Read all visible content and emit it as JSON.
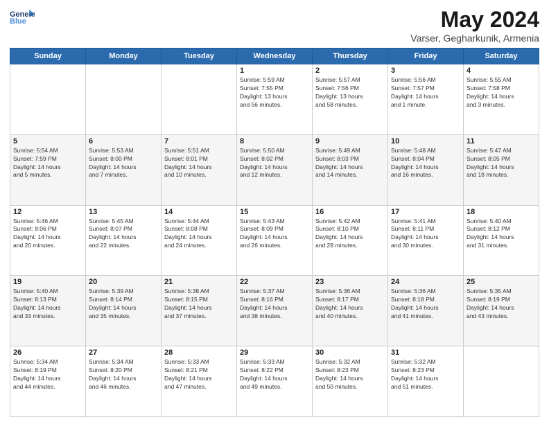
{
  "header": {
    "logo_line1": "General",
    "logo_line2": "Blue",
    "title": "May 2024",
    "location": "Varser, Gegharkunik, Armenia"
  },
  "weekdays": [
    "Sunday",
    "Monday",
    "Tuesday",
    "Wednesday",
    "Thursday",
    "Friday",
    "Saturday"
  ],
  "weeks": [
    {
      "days": [
        {
          "num": "",
          "info": ""
        },
        {
          "num": "",
          "info": ""
        },
        {
          "num": "",
          "info": ""
        },
        {
          "num": "1",
          "info": "Sunrise: 5:59 AM\nSunset: 7:55 PM\nDaylight: 13 hours\nand 56 minutes."
        },
        {
          "num": "2",
          "info": "Sunrise: 5:57 AM\nSunset: 7:56 PM\nDaylight: 13 hours\nand 58 minutes."
        },
        {
          "num": "3",
          "info": "Sunrise: 5:56 AM\nSunset: 7:57 PM\nDaylight: 14 hours\nand 1 minute."
        },
        {
          "num": "4",
          "info": "Sunrise: 5:55 AM\nSunset: 7:58 PM\nDaylight: 14 hours\nand 3 minutes."
        }
      ]
    },
    {
      "days": [
        {
          "num": "5",
          "info": "Sunrise: 5:54 AM\nSunset: 7:59 PM\nDaylight: 14 hours\nand 5 minutes."
        },
        {
          "num": "6",
          "info": "Sunrise: 5:53 AM\nSunset: 8:00 PM\nDaylight: 14 hours\nand 7 minutes."
        },
        {
          "num": "7",
          "info": "Sunrise: 5:51 AM\nSunset: 8:01 PM\nDaylight: 14 hours\nand 10 minutes."
        },
        {
          "num": "8",
          "info": "Sunrise: 5:50 AM\nSunset: 8:02 PM\nDaylight: 14 hours\nand 12 minutes."
        },
        {
          "num": "9",
          "info": "Sunrise: 5:49 AM\nSunset: 8:03 PM\nDaylight: 14 hours\nand 14 minutes."
        },
        {
          "num": "10",
          "info": "Sunrise: 5:48 AM\nSunset: 8:04 PM\nDaylight: 14 hours\nand 16 minutes."
        },
        {
          "num": "11",
          "info": "Sunrise: 5:47 AM\nSunset: 8:05 PM\nDaylight: 14 hours\nand 18 minutes."
        }
      ]
    },
    {
      "days": [
        {
          "num": "12",
          "info": "Sunrise: 5:46 AM\nSunset: 8:06 PM\nDaylight: 14 hours\nand 20 minutes."
        },
        {
          "num": "13",
          "info": "Sunrise: 5:45 AM\nSunset: 8:07 PM\nDaylight: 14 hours\nand 22 minutes."
        },
        {
          "num": "14",
          "info": "Sunrise: 5:44 AM\nSunset: 8:08 PM\nDaylight: 14 hours\nand 24 minutes."
        },
        {
          "num": "15",
          "info": "Sunrise: 5:43 AM\nSunset: 8:09 PM\nDaylight: 14 hours\nand 26 minutes."
        },
        {
          "num": "16",
          "info": "Sunrise: 5:42 AM\nSunset: 8:10 PM\nDaylight: 14 hours\nand 28 minutes."
        },
        {
          "num": "17",
          "info": "Sunrise: 5:41 AM\nSunset: 8:11 PM\nDaylight: 14 hours\nand 30 minutes."
        },
        {
          "num": "18",
          "info": "Sunrise: 5:40 AM\nSunset: 8:12 PM\nDaylight: 14 hours\nand 31 minutes."
        }
      ]
    },
    {
      "days": [
        {
          "num": "19",
          "info": "Sunrise: 5:40 AM\nSunset: 8:13 PM\nDaylight: 14 hours\nand 33 minutes."
        },
        {
          "num": "20",
          "info": "Sunrise: 5:39 AM\nSunset: 8:14 PM\nDaylight: 14 hours\nand 35 minutes."
        },
        {
          "num": "21",
          "info": "Sunrise: 5:38 AM\nSunset: 8:15 PM\nDaylight: 14 hours\nand 37 minutes."
        },
        {
          "num": "22",
          "info": "Sunrise: 5:37 AM\nSunset: 8:16 PM\nDaylight: 14 hours\nand 38 minutes."
        },
        {
          "num": "23",
          "info": "Sunrise: 5:36 AM\nSunset: 8:17 PM\nDaylight: 14 hours\nand 40 minutes."
        },
        {
          "num": "24",
          "info": "Sunrise: 5:36 AM\nSunset: 8:18 PM\nDaylight: 14 hours\nand 41 minutes."
        },
        {
          "num": "25",
          "info": "Sunrise: 5:35 AM\nSunset: 8:19 PM\nDaylight: 14 hours\nand 43 minutes."
        }
      ]
    },
    {
      "days": [
        {
          "num": "26",
          "info": "Sunrise: 5:34 AM\nSunset: 8:19 PM\nDaylight: 14 hours\nand 44 minutes."
        },
        {
          "num": "27",
          "info": "Sunrise: 5:34 AM\nSunset: 8:20 PM\nDaylight: 14 hours\nand 46 minutes."
        },
        {
          "num": "28",
          "info": "Sunrise: 5:33 AM\nSunset: 8:21 PM\nDaylight: 14 hours\nand 47 minutes."
        },
        {
          "num": "29",
          "info": "Sunrise: 5:33 AM\nSunset: 8:22 PM\nDaylight: 14 hours\nand 49 minutes."
        },
        {
          "num": "30",
          "info": "Sunrise: 5:32 AM\nSunset: 8:23 PM\nDaylight: 14 hours\nand 50 minutes."
        },
        {
          "num": "31",
          "info": "Sunrise: 5:32 AM\nSunset: 8:23 PM\nDaylight: 14 hours\nand 51 minutes."
        },
        {
          "num": "",
          "info": ""
        }
      ]
    }
  ]
}
